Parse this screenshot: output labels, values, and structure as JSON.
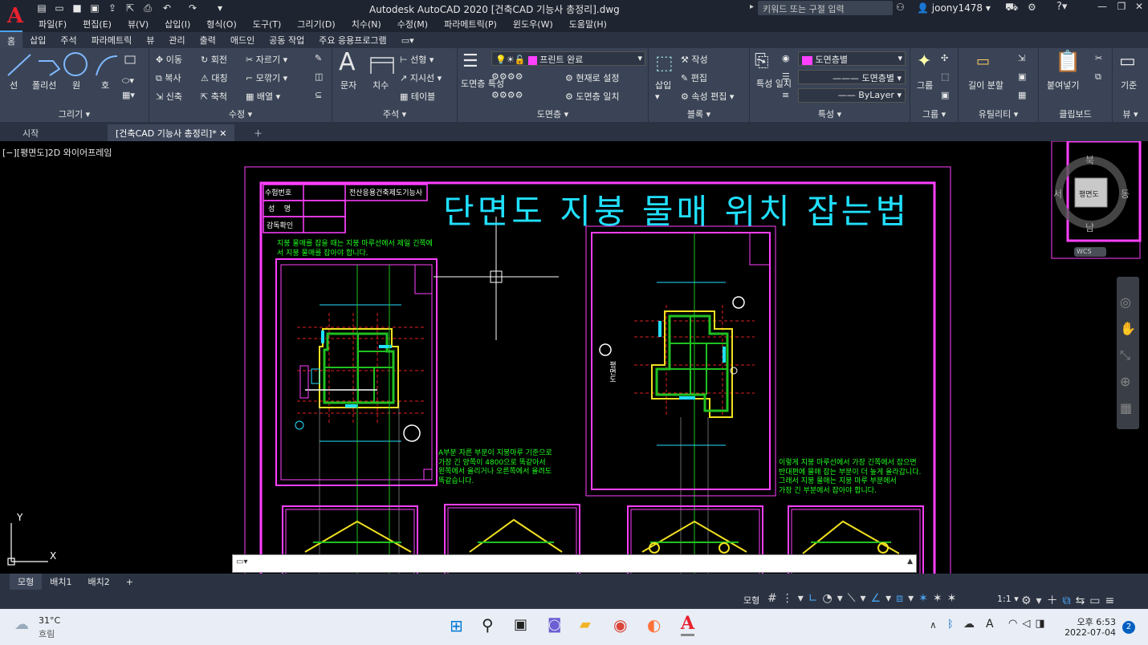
{
  "titlebar": {
    "app_title": "Autodesk AutoCAD 2020",
    "file_title": "[건축CAD 기능사 총정리].dwg",
    "search_placeholder": "키워드 또는 구절 입력",
    "username": "joony1478"
  },
  "menu": [
    "파일(F)",
    "편집(E)",
    "뷰(V)",
    "삽입(I)",
    "형식(O)",
    "도구(T)",
    "그리기(D)",
    "치수(N)",
    "수정(M)",
    "파라메트릭(P)",
    "윈도우(W)",
    "도움말(H)"
  ],
  "ribbon_tabs": [
    "홈",
    "삽입",
    "주석",
    "파라메트릭",
    "뷰",
    "관리",
    "출력",
    "애드인",
    "공동 작업",
    "주요 응용프로그램"
  ],
  "ribbon": {
    "draw": {
      "title": "그리기",
      "line": "선",
      "polyline": "폴리선",
      "circle": "원",
      "arc": "호"
    },
    "modify": {
      "title": "수정",
      "move": "이동",
      "rotate": "회전",
      "trim": "자르기",
      "copy": "복사",
      "mirror": "대칭",
      "fillet": "모깎기",
      "stretch": "신축",
      "scale": "축척",
      "array": "배열"
    },
    "annotation": {
      "title": "주석",
      "text": "문자",
      "dimension": "치수",
      "linear": "선형",
      "leader": "지시선",
      "table": "테이블"
    },
    "layers": {
      "title": "도면층",
      "props": "도면층 특성",
      "current_layer": "프린트 완료",
      "make_current": "현재로 설정",
      "match": "도면층 일치"
    },
    "block": {
      "title": "블록",
      "insert": "삽입",
      "create": "작성",
      "edit": "편집",
      "attr_edit": "속성 편집"
    },
    "properties": {
      "title": "특성",
      "match": "특성 일치",
      "color": "도면층별",
      "linetype": "도면층별",
      "lineweight": "ByLayer"
    },
    "groups": {
      "title": "그룹",
      "group": "그룹"
    },
    "utilities": {
      "title": "유틸리티",
      "measure": "길이 분할"
    },
    "clipboard": {
      "title": "클립보드",
      "paste": "붙여넣기"
    },
    "view": {
      "title": "뷰",
      "base": "기준"
    }
  },
  "doc_tabs": {
    "start": "시작",
    "drawing": "[건축CAD 기능사 총정리]*"
  },
  "viewport": {
    "label": "[−][평면도]2D 와이어프레임"
  },
  "drawing": {
    "title": "단면도 지붕 물매 위치 잡는법",
    "table": {
      "r1a": "수험번호",
      "r1b": "전산응용건축제도기능사",
      "r2": "성    명",
      "r3": "감독확인"
    },
    "note1": "지붕 물매를 잡을 때는 지붕 마루선에서 제일 긴쪽에\n서 지붕 물매를 잡아야 합니다.",
    "note2": "A부분 자른 부분이 지붕마루 기준으로\n가장 긴 양쪽이 4800으로 똑같아서\n왼쪽에서 올리거나 오른쪽에서 올려도\n똑같습니다.",
    "note3": "이렇게 지붕 마루선에서 가장 긴쪽에서 잡으면\n반대편에 물매 잡는 부분이 더 높게 올라갑니다.\n그래서 지붕 물매는 지붕 마루 부분에서\n가장 긴 부분에서 잡아야 합니다.",
    "plan_label": "평면도"
  },
  "viewcube": {
    "north": "북",
    "south": "남",
    "west": "서",
    "east": "동",
    "face": "평면도",
    "wcs": "WCS"
  },
  "layout_tabs": [
    "모형",
    "배치1",
    "배치2",
    "+"
  ],
  "status": {
    "model": "모형",
    "scale": "1:1"
  },
  "taskbar": {
    "weather_temp": "31°C",
    "weather_desc": "흐림",
    "time": "오후 6:53",
    "date": "2022-07-04",
    "notif": "2",
    "lang": "A"
  }
}
